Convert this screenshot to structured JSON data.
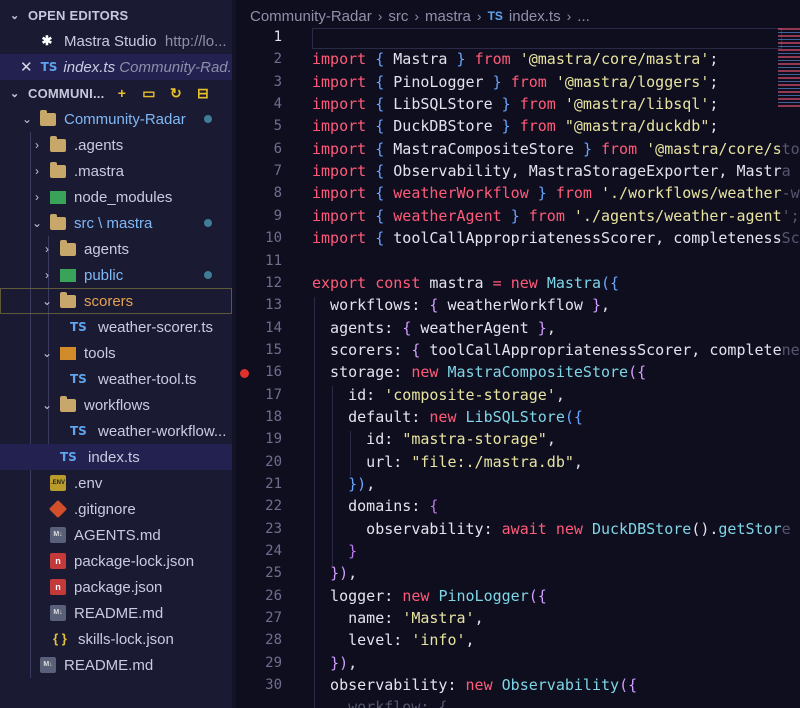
{
  "sidebar": {
    "open_editors_title": "OPEN EDITORS",
    "open_editors": [
      {
        "name": "Mastra Studio",
        "detail": "http://lo..."
      },
      {
        "name": "index.ts",
        "detail": "Community-Rad..."
      }
    ],
    "workspace_title": "COMMUNI...",
    "tree": [
      {
        "label": "Community-Radar"
      },
      {
        "label": ".agents"
      },
      {
        "label": ".mastra"
      },
      {
        "label": "node_modules"
      },
      {
        "label": "src \\ mastra"
      },
      {
        "label": "agents"
      },
      {
        "label": "public"
      },
      {
        "label": "scorers"
      },
      {
        "label": "weather-scorer.ts"
      },
      {
        "label": "tools"
      },
      {
        "label": "weather-tool.ts"
      },
      {
        "label": "workflows"
      },
      {
        "label": "weather-workflow..."
      },
      {
        "label": "index.ts"
      },
      {
        "label": ".env"
      },
      {
        "label": ".gitignore"
      },
      {
        "label": "AGENTS.md"
      },
      {
        "label": "package-lock.json"
      },
      {
        "label": "package.json"
      },
      {
        "label": "README.md"
      },
      {
        "label": "skills-lock.json"
      },
      {
        "label": "README.md"
      }
    ]
  },
  "icons": {
    "ts": "TS",
    "md": "M↓",
    "json": "{ }",
    "env": ".ENV",
    "npm": "n",
    "mastra": "✱"
  },
  "breadcrumb": {
    "root": "Community-Radar",
    "src": "src",
    "mastra": "mastra",
    "file": "index.ts",
    "more": "..."
  },
  "editor": {
    "line_numbers": [
      "1",
      "2",
      "3",
      "4",
      "5",
      "6",
      "7",
      "8",
      "9",
      "10",
      "11",
      "12",
      "13",
      "14",
      "15",
      "16",
      "17",
      "18",
      "19",
      "20",
      "21",
      "22",
      "23",
      "24",
      "25",
      "26",
      "27",
      "28",
      "29",
      "30"
    ],
    "active_line": 1,
    "breakpoint_line": 16
  },
  "colors": {
    "keyword": "#ff5b79",
    "class": "#7ed6e6",
    "string": "#e8e3a1",
    "breakpoint": "#e0312a"
  }
}
